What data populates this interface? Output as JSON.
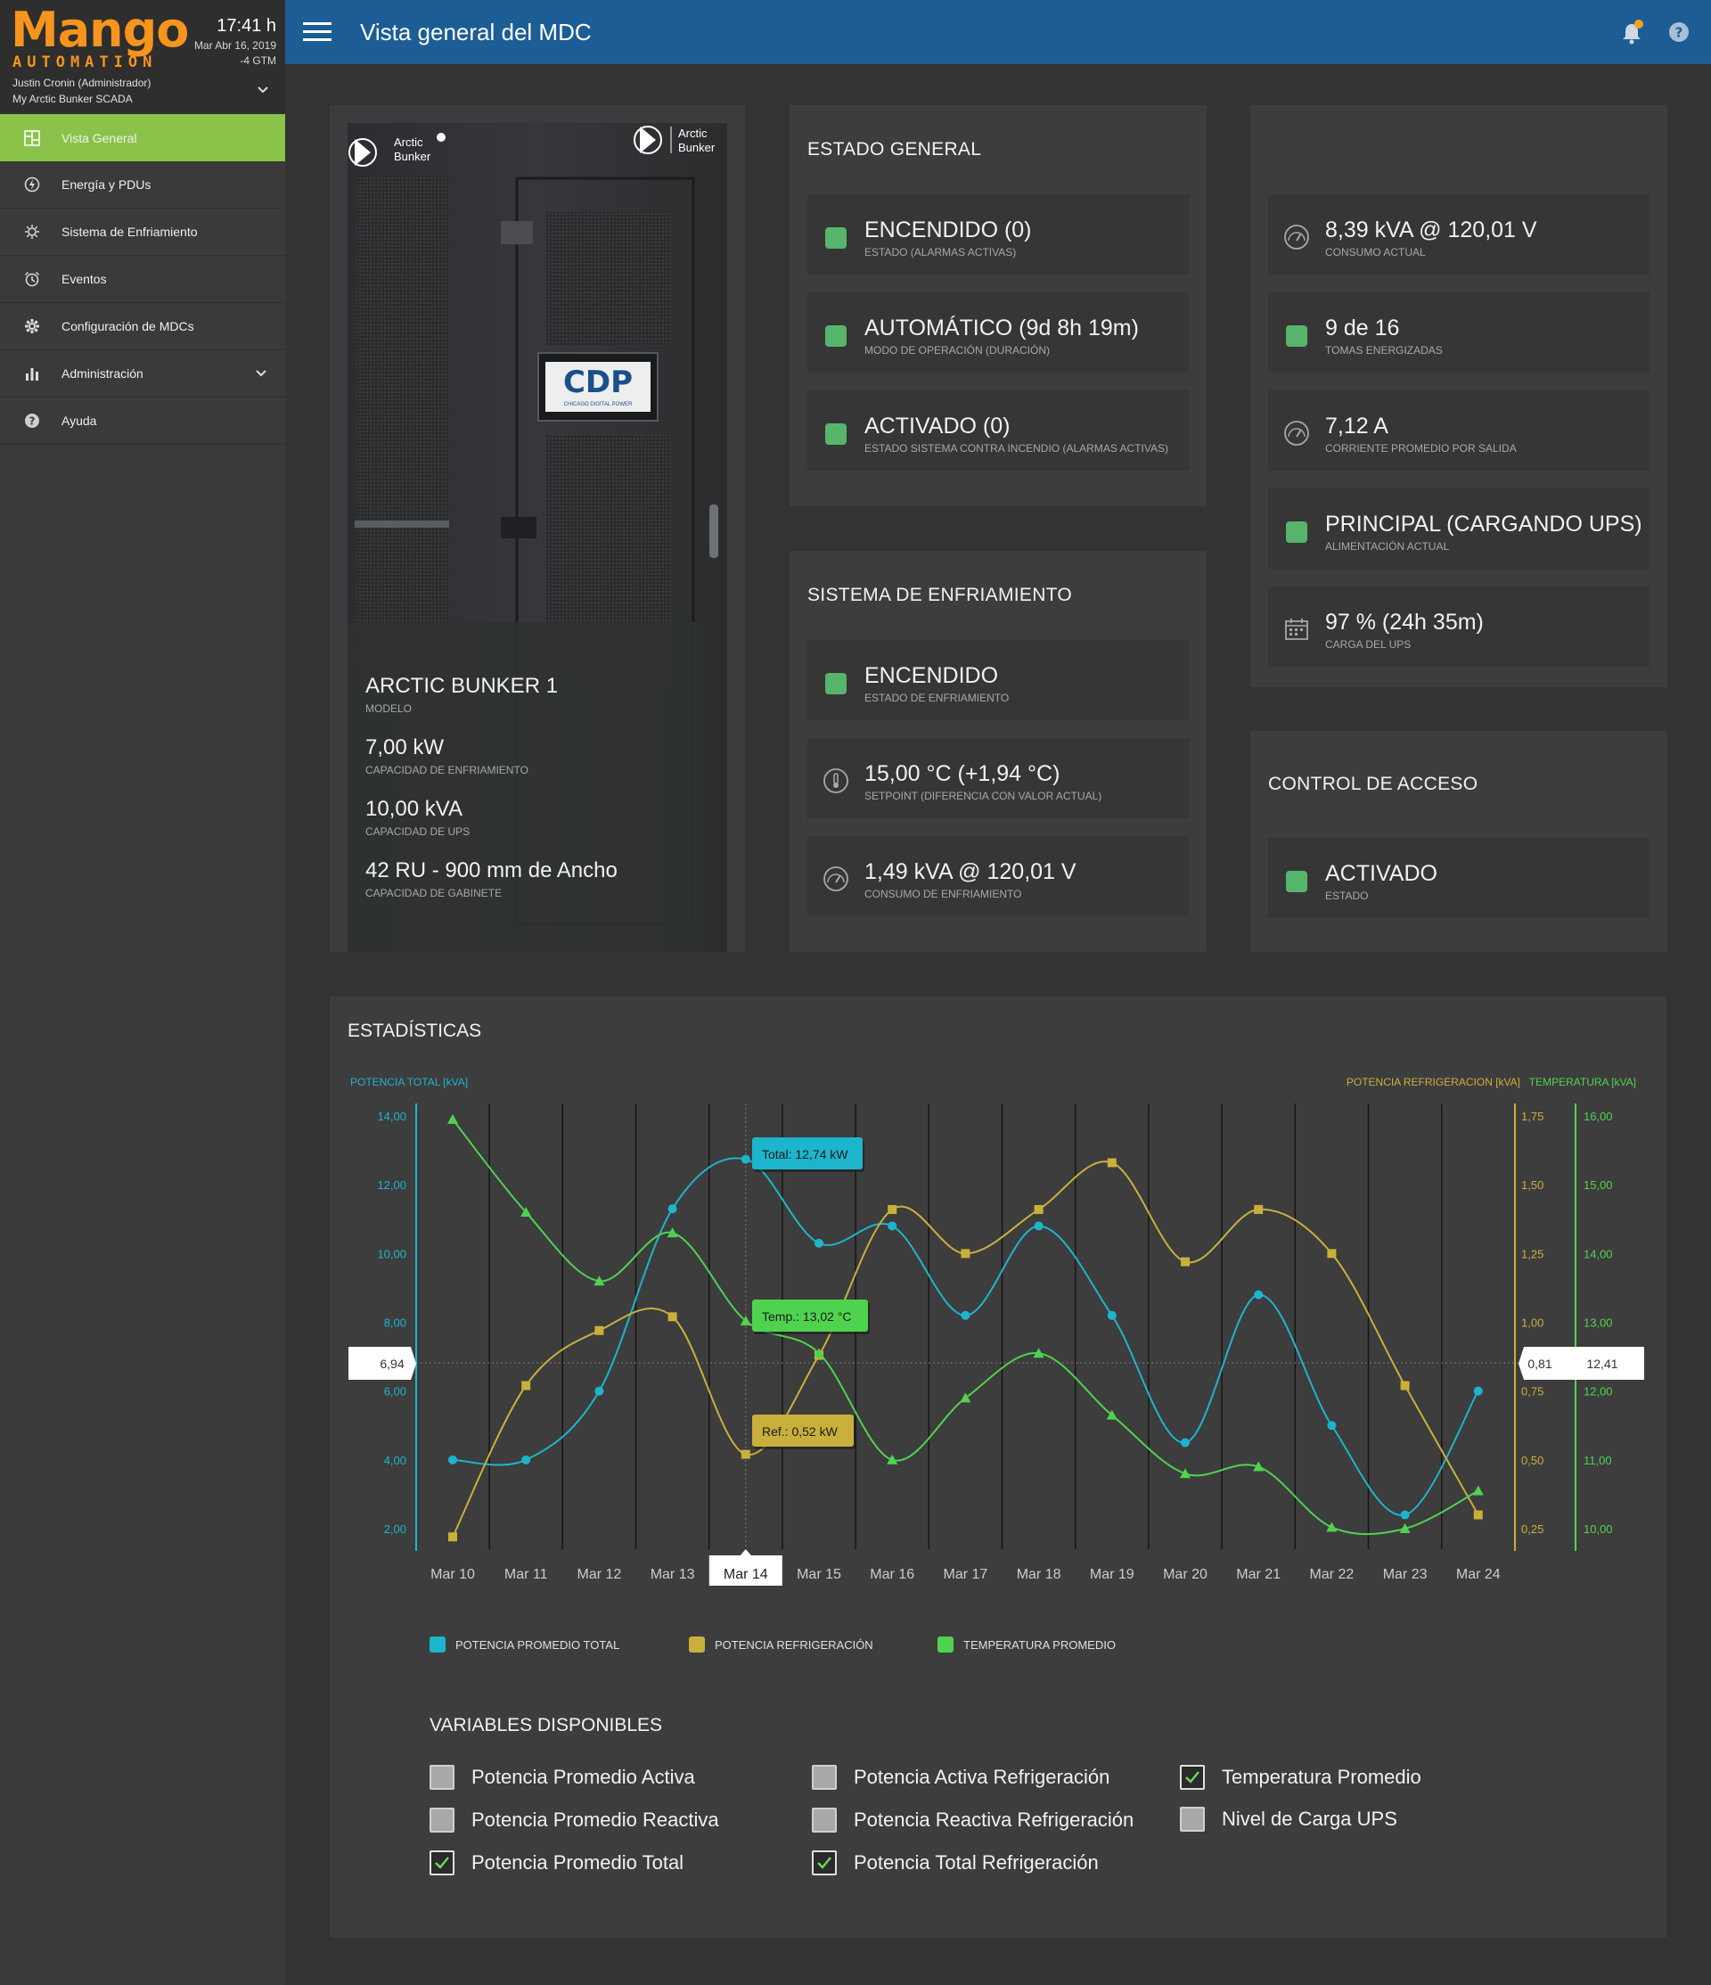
{
  "sidebar": {
    "brand": "Mango",
    "brand_sub": "AUTOMATION",
    "time": "17:41 h",
    "date": "Mar Abr 16, 2019",
    "tz": "-4 GTM",
    "user": "Justin Cronin (Administrador)",
    "site": "My Arctic Bunker SCADA",
    "items": [
      {
        "label": "Vista General",
        "icon": "dashboard-icon"
      },
      {
        "label": "Energía y PDUs",
        "icon": "power-icon"
      },
      {
        "label": "Sistema de Enfriamiento",
        "icon": "cooling-icon"
      },
      {
        "label": "Eventos",
        "icon": "alarm-clock-icon"
      },
      {
        "label": "Configuración de MDCs",
        "icon": "gear-icon"
      },
      {
        "label": "Administración",
        "icon": "bar-chart-icon"
      },
      {
        "label": "Ayuda",
        "icon": "help-icon"
      }
    ]
  },
  "topbar": {
    "title": "Vista general del MDC"
  },
  "cabinet": {
    "brand_left": [
      "Arctic",
      "Bunker"
    ],
    "brand_right": [
      "Arctic",
      "Bunker"
    ],
    "badge_top": "CDP",
    "badge_sub": "CHICAGO DIGITAL POWER",
    "specs": [
      {
        "value": "ARCTIC BUNKER 1",
        "label": "MODELO"
      },
      {
        "value": "7,00 kW",
        "label": "CAPACIDAD DE ENFRIAMIENTO"
      },
      {
        "value": "10,00 kVA",
        "label": "CAPACIDAD DE UPS"
      },
      {
        "value": "42 RU - 900 mm de Ancho",
        "label": "CAPACIDAD DE GABINETE"
      }
    ]
  },
  "estado_general": {
    "title": "ESTADO GENERAL",
    "rows": [
      {
        "value": "ENCENDIDO (0)",
        "label": "ESTADO (ALARMAS ACTIVAS)"
      },
      {
        "value": "AUTOMÁTICO (9d 8h 19m)",
        "label": "MODO DE OPERACIÓN (DURACIÓN)"
      },
      {
        "value": "ACTIVADO (0)",
        "label": "ESTADO SISTEMA CONTRA INCENDIO (ALARMAS ACTIVAS)"
      }
    ]
  },
  "enfriamiento": {
    "title": "SISTEMA DE ENFRIAMIENTO",
    "rows": [
      {
        "value": "ENCENDIDO",
        "label": "ESTADO DE ENFRIAMIENTO"
      },
      {
        "value": "15,00 °C (+1,94 °C)",
        "label": "SETPOINT (DIFERENCIA CON VALOR ACTUAL)"
      },
      {
        "value": "1,49 kVA @ 120,01 V",
        "label": "CONSUMO DE ENFRIAMIENTO"
      }
    ]
  },
  "energia": {
    "rows": [
      {
        "value": "8,39 kVA @ 120,01 V",
        "label": "CONSUMO ACTUAL"
      },
      {
        "value": "9 de 16",
        "label": "TOMAS ENERGIZADAS"
      },
      {
        "value": "7,12 A",
        "label": "CORRIENTE PROMEDIO POR SALIDA"
      },
      {
        "value": "PRINCIPAL (CARGANDO UPS)",
        "label": "ALIMENTACIÓN ACTUAL"
      },
      {
        "value": "97 % (24h 35m)",
        "label": "CARGA DEL UPS"
      }
    ]
  },
  "acceso": {
    "title": "CONTROL DE ACCESO",
    "rows": [
      {
        "value": "ACTIVADO",
        "label": "ESTADO"
      }
    ]
  },
  "stats": {
    "title": "ESTADÍSTICAS",
    "left_axis_title": "POTENCIA TOTAL [kVA]",
    "right_axis_title_1": "POTENCIA REFRIGERACION [kVA]",
    "right_axis_title_2": "TEMPERATURA [kVA]",
    "cursor_left": "6,94",
    "cursor_right_1": "0,81",
    "cursor_right_2": "12,41",
    "tooltip_total": "Total: 12,74 kW",
    "tooltip_temp": "Temp.: 13,02 °C",
    "tooltip_ref": "Ref.: 0,52 kW",
    "legend": [
      {
        "label": "POTENCIA PROMEDIO TOTAL",
        "color": "#1db5cc"
      },
      {
        "label": "POTENCIA REFRIGERACIÓN",
        "color": "#c9b03b"
      },
      {
        "label": "TEMPERATURA PROMEDIO",
        "color": "#4fd34f"
      }
    ],
    "vars_title": "VARIABLES DISPONIBLES",
    "vars": [
      {
        "label": "Potencia Promedio Activa",
        "checked": false
      },
      {
        "label": "Potencia Promedio Reactiva",
        "checked": false
      },
      {
        "label": "Potencia Promedio Total",
        "checked": true
      },
      {
        "label": "Potencia Activa Refrigeración",
        "checked": false
      },
      {
        "label": "Potencia Reactiva Refrigeración",
        "checked": false
      },
      {
        "label": "Potencia Total Refrigeración",
        "checked": true
      },
      {
        "label": "Temperatura Promedio",
        "checked": true
      },
      {
        "label": "Nivel de Carga UPS",
        "checked": false
      }
    ]
  },
  "chart_data": {
    "type": "line",
    "categories": [
      "Mar 10",
      "Mar 11",
      "Mar 12",
      "Mar 13",
      "Mar 14",
      "Mar 15",
      "Mar 16",
      "Mar 17",
      "Mar 18",
      "Mar 19",
      "Mar 20",
      "Mar 21",
      "Mar 22",
      "Mar 23",
      "Mar 24"
    ],
    "selected_category": "Mar 14",
    "axes": {
      "left": {
        "ticks": [
          "14,00",
          "12,00",
          "10,00",
          "8,00",
          "6,00",
          "4,00",
          "2,00"
        ],
        "range": [
          2,
          14
        ]
      },
      "right1": {
        "ticks": [
          "1,75",
          "1,50",
          "1,25",
          "1,00",
          "0,75",
          "0,50",
          "0,25"
        ],
        "range": [
          0.25,
          1.75
        ]
      },
      "right2": {
        "ticks": [
          "16,00",
          "15,00",
          "14,00",
          "13,00",
          "12,00",
          "11,00",
          "10,00"
        ],
        "range": [
          10,
          16
        ]
      }
    },
    "series": [
      {
        "name": "POTENCIA PROMEDIO TOTAL",
        "axis": "left",
        "color": "#1db5cc",
        "marker": "circle",
        "values": [
          4.0,
          4.0,
          6.0,
          11.3,
          12.74,
          10.3,
          10.8,
          8.2,
          10.8,
          8.2,
          4.5,
          8.8,
          5.0,
          2.4,
          6.0
        ]
      },
      {
        "name": "POTENCIA REFRIGERACIÓN",
        "axis": "right1",
        "color": "#c9b03b",
        "marker": "square",
        "values": [
          0.22,
          0.77,
          0.97,
          1.02,
          0.52,
          0.88,
          1.41,
          1.25,
          1.41,
          1.58,
          1.22,
          1.41,
          1.25,
          0.77,
          0.3
        ]
      },
      {
        "name": "TEMPERATURA PROMEDIO",
        "axis": "right2",
        "color": "#4fd34f",
        "marker": "triangle",
        "values": [
          15.95,
          14.6,
          13.6,
          14.3,
          13.02,
          12.55,
          11.0,
          11.9,
          12.55,
          11.65,
          10.8,
          10.9,
          10.02,
          10.0,
          10.55
        ]
      }
    ]
  }
}
